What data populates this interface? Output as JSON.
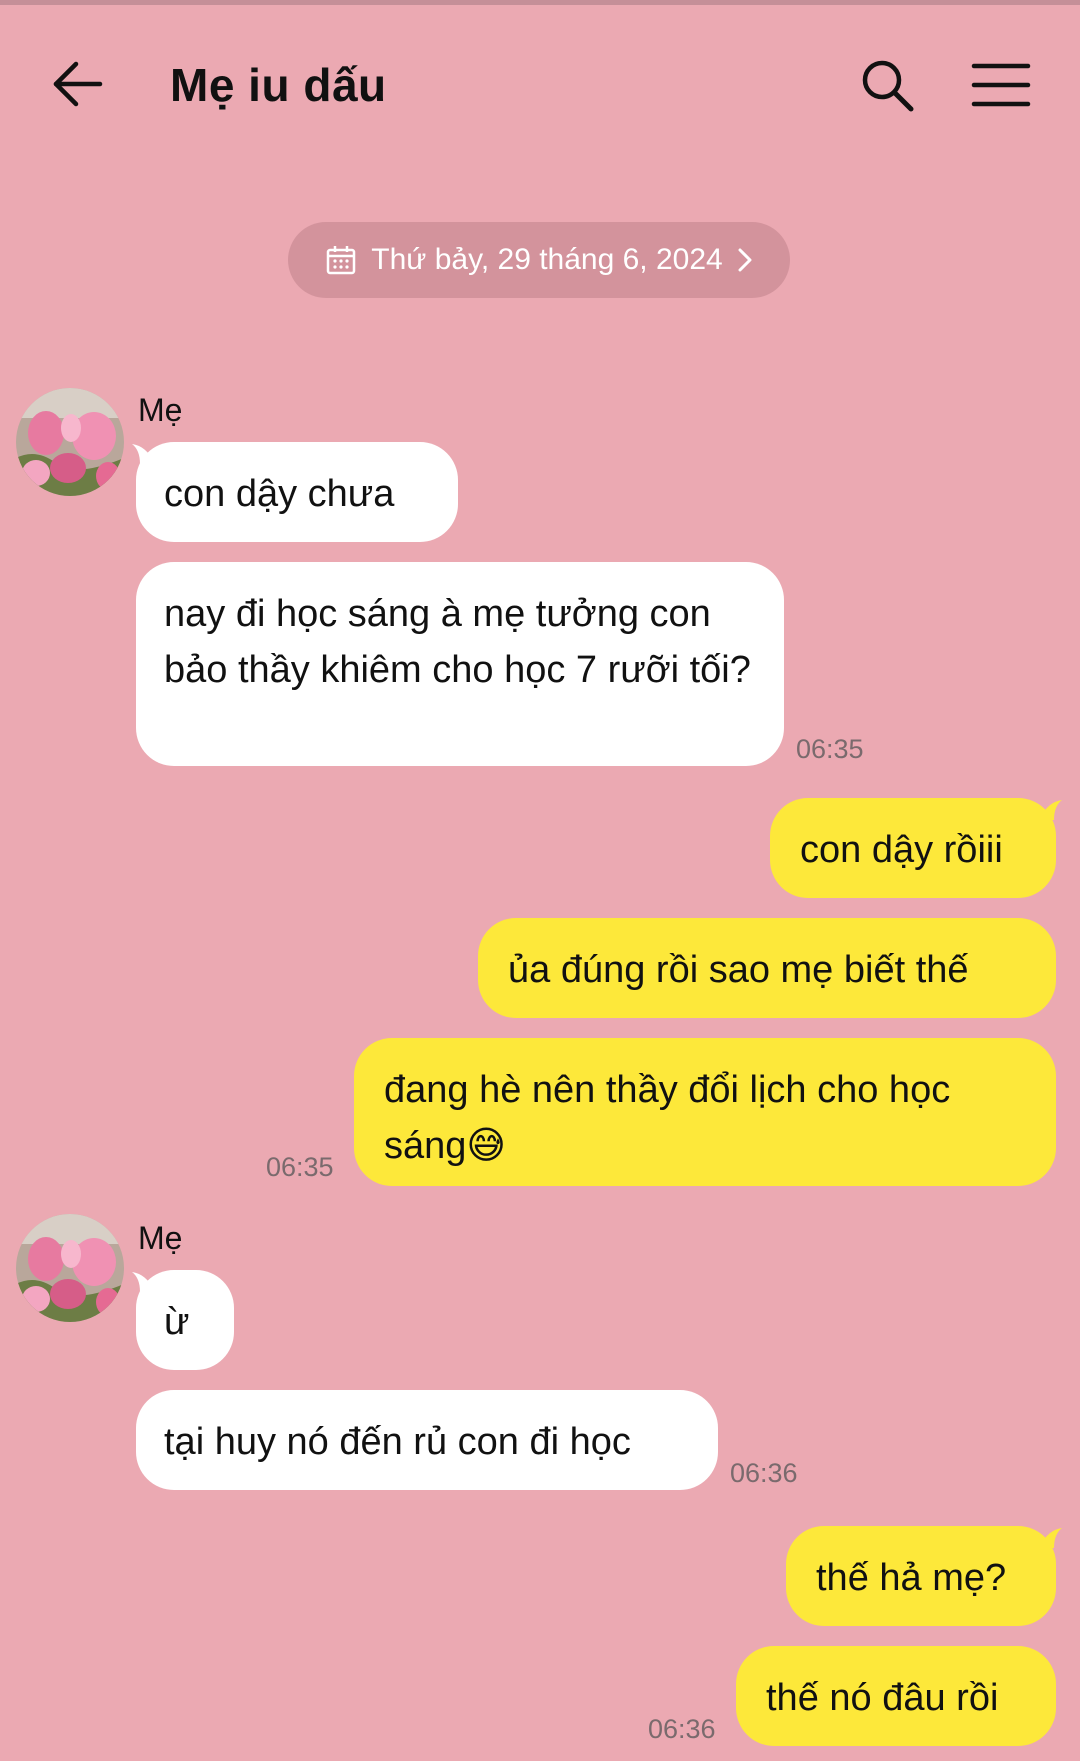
{
  "header": {
    "title": "Mẹ iu dấu",
    "back_icon": "arrow-left-icon",
    "search_icon": "search-icon",
    "menu_icon": "hamburger-menu-icon"
  },
  "date_separator": {
    "label": "Thứ bảy, 29 tháng 6, 2024",
    "icon": "calendar-icon"
  },
  "messages": [
    {
      "sender": "Mẹ",
      "text": "con dậy chưa"
    },
    {
      "text": "nay đi học sáng à mẹ tưởng con bảo thầy khiêm cho học 7 rưỡi tối?",
      "time": "06:35"
    },
    {
      "text": "con dậy rồiii"
    },
    {
      "text": "ủa đúng rồi sao mẹ biết thế"
    },
    {
      "text": "đang hè nên thầy đổi lịch cho học sáng",
      "emoji": "😅",
      "time": "06:35"
    },
    {
      "sender": "Mẹ",
      "text": "ừ"
    },
    {
      "text": "tại huy nó đến rủ con đi học",
      "time": "06:36"
    },
    {
      "text": "thế hả mẹ?"
    },
    {
      "text": "thế nó đâu rồi",
      "time": "06:36"
    }
  ],
  "colors": {
    "background": "#eba9b2",
    "incoming_bubble": "#ffffff",
    "outgoing_bubble": "#fde83a",
    "date_pill": "#d3939c"
  }
}
